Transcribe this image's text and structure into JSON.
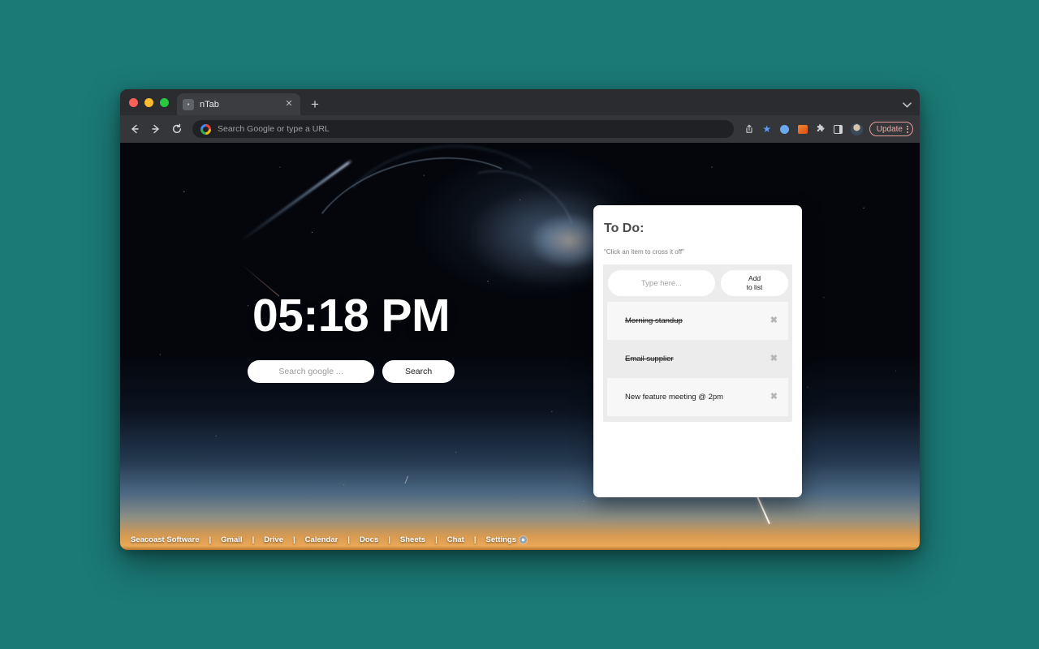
{
  "desktop": {
    "background_color": "#1b7a76"
  },
  "browser": {
    "traffic_lights": [
      "close",
      "minimize",
      "maximize"
    ],
    "tab": {
      "title": "nTab",
      "favicon": "▪",
      "close_label": "✕"
    },
    "new_tab_label": "+",
    "tab_list_chevron": "⌄",
    "toolbar": {
      "back_label": "←",
      "forward_label": "→",
      "reload_label": "↻",
      "omnibox_placeholder": "Search Google or type a URL",
      "share_label": "↑",
      "bookmark_label": "★",
      "update_label": "Update"
    }
  },
  "newtab": {
    "clock": "05:18 PM",
    "search": {
      "placeholder": "Search google ...",
      "value": "",
      "button_label": "Search"
    },
    "todo": {
      "title": "To Do:",
      "hint": "\"Click an item to cross it off\"",
      "input_placeholder": "Type here...",
      "input_value": "",
      "add_button_line1": "Add",
      "add_button_line2": "to list",
      "remove_label": "✖",
      "items": [
        {
          "label": "Morning standup",
          "done": true
        },
        {
          "label": "Email supplier",
          "done": true
        },
        {
          "label": "New feature meeting @ 2pm",
          "done": false
        }
      ]
    },
    "bottom_nav": {
      "brand": "Seacoast Software",
      "separator": "|",
      "links": [
        "Gmail",
        "Drive",
        "Calendar",
        "Docs",
        "Sheets",
        "Chat",
        "Settings"
      ]
    }
  }
}
